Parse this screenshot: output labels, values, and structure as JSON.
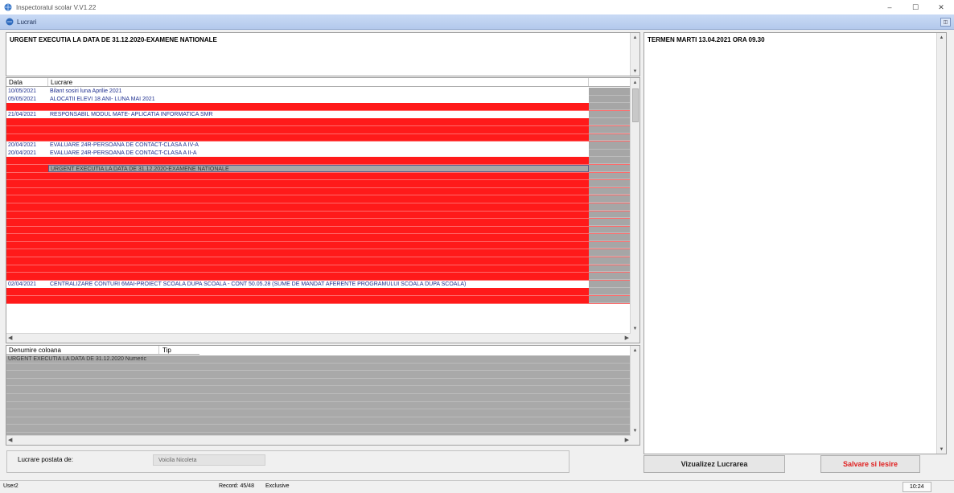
{
  "window": {
    "title": "Inspectoratul scolar V.V1.22",
    "minimize": "–",
    "maximize": "☐",
    "close": "✕"
  },
  "child": {
    "title": "Lucrari",
    "btn": "◫"
  },
  "urgent_text": "URGENT EXECUTIA LA DATA DE 31.12.2020-EXAMENE NATIONALE",
  "termen_text": "TERMEN MARTI 13.04.2021 ORA 09.30",
  "grid": {
    "col_data": "Data",
    "col_lucrare": "Lucrare",
    "rows": [
      {
        "date": "10/05/2021",
        "text": "Bilant sosiri luna Aprilie 2021",
        "style": "white"
      },
      {
        "date": "05/05/2021",
        "text": "ALOCATII ELEVI 18 ANI- LUNA MAI 2021",
        "style": "white"
      },
      {
        "date": "",
        "text": "",
        "style": "red"
      },
      {
        "date": "21/04/2021",
        "text": "RESPONSABIL MODUL MATE- APLICATIA INFORMATICA SMR",
        "style": "white"
      },
      {
        "date": "",
        "text": "",
        "style": "red"
      },
      {
        "date": "",
        "text": "",
        "style": "red"
      },
      {
        "date": "",
        "text": "",
        "style": "red"
      },
      {
        "date": "20/04/2021",
        "text": "EVALUARE 24R-PERSOANA DE CONTACT-CLASA A IV-A",
        "style": "white"
      },
      {
        "date": "20/04/2021",
        "text": "EVALUARE 24R-PERSOANA DE CONTACT-CLASA A II-A",
        "style": "white"
      },
      {
        "date": "",
        "text": "",
        "style": "red"
      },
      {
        "date": "",
        "text": "URGENT EXECUTIA LA DATA DE 31.12.2020-EXAMENE NATIONALE",
        "style": "red selected"
      },
      {
        "date": "",
        "text": "",
        "style": "red"
      },
      {
        "date": "",
        "text": "",
        "style": "red"
      },
      {
        "date": "",
        "text": "",
        "style": "red"
      },
      {
        "date": "",
        "text": "",
        "style": "red"
      },
      {
        "date": "",
        "text": "",
        "style": "red"
      },
      {
        "date": "",
        "text": "",
        "style": "red"
      },
      {
        "date": "",
        "text": "",
        "style": "red"
      },
      {
        "date": "",
        "text": "",
        "style": "red"
      },
      {
        "date": "",
        "text": "",
        "style": "red"
      },
      {
        "date": "",
        "text": "",
        "style": "red"
      },
      {
        "date": "",
        "text": "",
        "style": "red"
      },
      {
        "date": "",
        "text": "",
        "style": "red"
      },
      {
        "date": "",
        "text": "",
        "style": "red"
      },
      {
        "date": "",
        "text": "",
        "style": "red"
      },
      {
        "date": "02/04/2021",
        "text": "CENTRALIZARE CONTURI 6MAI-PROIECT SCOALA DUPA SCOALA - CONT 50.05.28 (SUME DE MANDAT AFERENTE PROGRAMULUI SCOALA DUPA SCOALA)",
        "style": "white"
      },
      {
        "date": "",
        "text": "",
        "style": "red"
      },
      {
        "date": "",
        "text": "",
        "style": "red"
      }
    ]
  },
  "denumire": {
    "col_denumire": "Denumire coloana",
    "col_tip": "Tip",
    "first_row": "URGENT EXECUTIA LA DATA DE 31.12.2020 Numeric"
  },
  "bottom": {
    "postata_label": "Lucrare postata de:",
    "postata_value": "Voicila Nicoleta",
    "btn_visualize": "Vizualizez Lucrarea",
    "btn_save": "Salvare si Iesire"
  },
  "status": {
    "user": "User2",
    "record": "Record: 45/48",
    "mode": "Exclusive",
    "time": "10:24"
  },
  "colors": {
    "red_row": "#ff1a1a",
    "white_row_text": "#1f2f8f",
    "save_text": "#e01f1f",
    "title_gradient": "#c9daf5"
  }
}
